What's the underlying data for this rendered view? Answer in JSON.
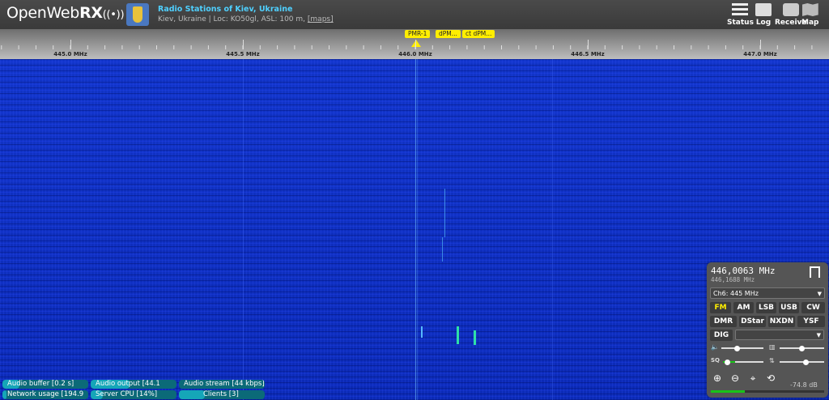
{
  "header": {
    "logo": {
      "prefix": "OpenWeb",
      "suffix": "RX"
    },
    "receiver_title": "Radio Stations of Kiev, Ukraine",
    "receiver_location": "Kiev, Ukraine | Loc: KO50gl, ASL: 100 m,",
    "maps_link": "[maps]",
    "buttons": {
      "status": "Status",
      "log": "Log",
      "receive": "Receive",
      "map": "Map"
    }
  },
  "scale": {
    "labels": [
      "445.0 MHz",
      "445.5 MHz",
      "446.0 MHz",
      "446.5 MHz",
      "447.0 MHz"
    ],
    "bookmarks": [
      "PMR-1",
      "dPM...",
      "ct dPM..."
    ]
  },
  "status_bars": {
    "audio_buffer": {
      "label": "Audio buffer [0.2 s]",
      "level": 0.2
    },
    "audio_output": {
      "label": "Audio output [44.1",
      "level": 0.45
    },
    "audio_stream": {
      "label": "Audio stream [44 kbps]",
      "level": 0.0
    },
    "network_usage": {
      "label": "Network usage [194.9",
      "level": 0.05
    },
    "server_cpu": {
      "label": "Server CPU [14%]",
      "level": 0.14
    },
    "clients": {
      "label": "Clients [3]",
      "level": 0.3
    }
  },
  "receiver_panel": {
    "frequency": "446,0063 MHz",
    "offset_frequency": "446,1688 MHz",
    "preset": "Ch6: 445 MHz",
    "modes_row1": [
      "FM",
      "AM",
      "LSB",
      "USB",
      "CW"
    ],
    "modes_row2": [
      "DMR",
      "DStar",
      "NXDN",
      "YSF"
    ],
    "active_mode": "FM",
    "digital_button": "DIG",
    "smeter_value": "-74.8 dB",
    "smeter_level": 0.3,
    "volume_level": 0.35,
    "nr_level": 0.5,
    "squelch_level": 0.05,
    "gain_level": 0.6
  }
}
